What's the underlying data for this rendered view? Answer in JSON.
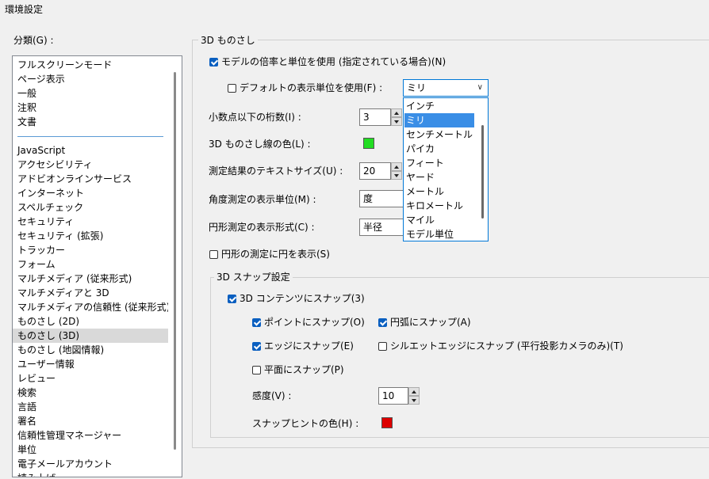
{
  "window": {
    "title": "環境設定"
  },
  "categories": {
    "label": "分類(G) :",
    "top_items": [
      "フルスクリーンモード",
      "ページ表示",
      "一般",
      "注釈",
      "文書"
    ],
    "items": [
      "JavaScript",
      "アクセシビリティ",
      "アドビオンラインサービス",
      "インターネット",
      "スペルチェック",
      "セキュリティ",
      "セキュリティ (拡張)",
      "トラッカー",
      "フォーム",
      "マルチメディア (従来形式)",
      "マルチメディアと 3D",
      "マルチメディアの信頼性 (従来形式)",
      "ものさし (2D)",
      "ものさし (3D)",
      "ものさし (地図情報)",
      "ユーザー情報",
      "レビュー",
      "検索",
      "言語",
      "署名",
      "信頼性管理マネージャー",
      "単位",
      "電子メールアカウント",
      "読み上げ"
    ],
    "selected": "ものさし (3D)"
  },
  "ruler3d": {
    "group_title": "3D ものさし",
    "use_model_scale_label": "モデルの倍率と単位を使用 (指定されている場合)(N)",
    "use_model_scale_checked": true,
    "use_default_units_label": "デフォルトの表示単位を使用(F) :",
    "use_default_units_checked": false,
    "units_value": "ミリ",
    "units_options": [
      "インチ",
      "ミリ",
      "センチメートル",
      "パイカ",
      "フィート",
      "ヤード",
      "メートル",
      "キロメートル",
      "マイル",
      "モデル単位"
    ],
    "decimal_label": "小数点以下の桁数(I) :",
    "decimal_value": "3",
    "line_color_label": "3D ものさし線の色(L) :",
    "line_color": "#22dd22",
    "text_size_label": "測定結果のテキストサイズ(U) :",
    "text_size_value": "20",
    "angle_label": "角度測定の表示単位(M) :",
    "angle_value": "度",
    "circle_label": "円形測定の表示形式(C) :",
    "circle_value": "半径",
    "show_circle_label": "円形の測定に円を表示(S)",
    "show_circle_checked": false
  },
  "snap": {
    "group_title": "3D スナップ設定",
    "enable_label": "3D コンテンツにスナップ(3)",
    "enable_checked": true,
    "point_label": "ポイントにスナップ(O)",
    "point_checked": true,
    "arc_label": "円弧にスナップ(A)",
    "arc_checked": true,
    "edge_label": "エッジにスナップ(E)",
    "edge_checked": true,
    "silhouette_label": "シルエットエッジにスナップ (平行投影カメラのみ)(T)",
    "silhouette_checked": false,
    "plane_label": "平面にスナップ(P)",
    "plane_checked": false,
    "sensitivity_label": "感度(V) :",
    "sensitivity_value": "10",
    "hint_color_label": "スナップヒントの色(H) :",
    "hint_color": "#dd0000"
  }
}
